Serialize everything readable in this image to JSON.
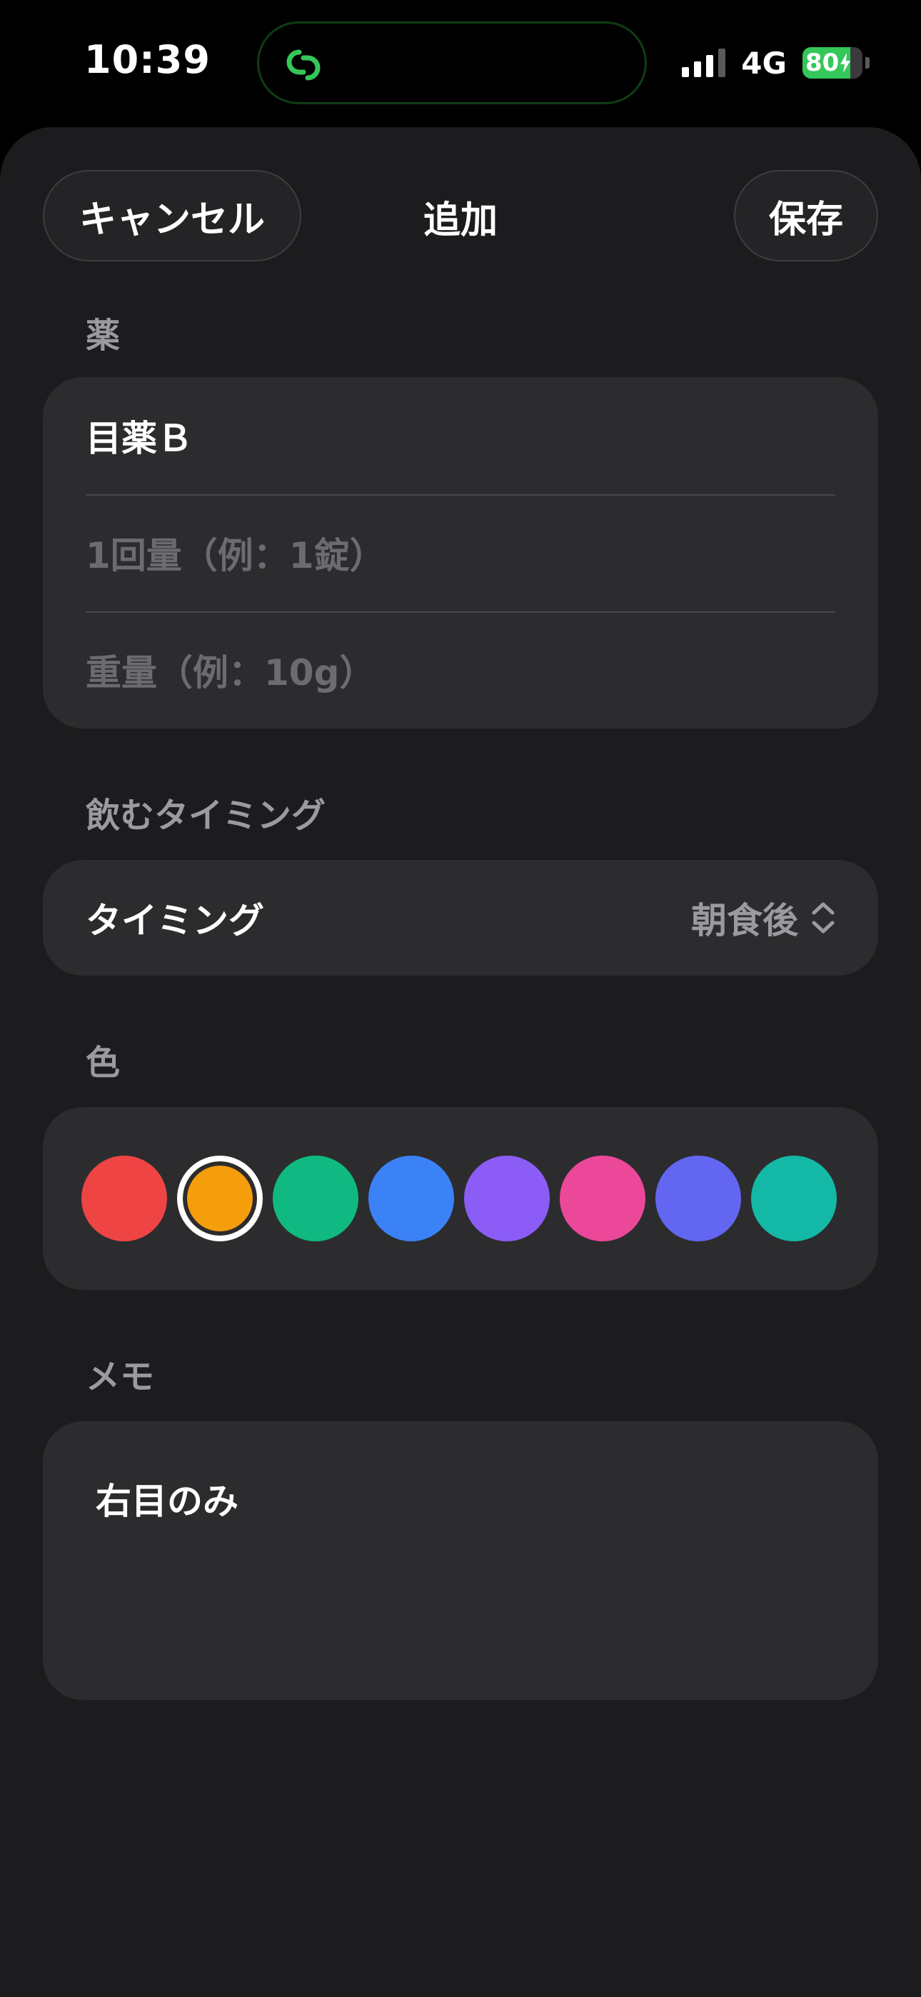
{
  "status_bar": {
    "time": "10:39",
    "network": "4G",
    "battery_label": "80",
    "battery_level": 0.8,
    "signal_bars": 3,
    "icons": [
      "link-icon",
      "signal-icon",
      "battery-icon",
      "charging-bolt-icon"
    ]
  },
  "nav": {
    "cancel_label": "キャンセル",
    "title": "追加",
    "save_label": "保存"
  },
  "medicine_section": {
    "label": "薬",
    "name_value": "目薬Ｂ",
    "dose_placeholder": "1回量（例：1錠）",
    "weight_placeholder": "重量（例：10g）"
  },
  "timing_section": {
    "label": "飲むタイミング",
    "row_label": "タイミング",
    "selected_value": "朝食後",
    "icon": "chevron-up-down-icon"
  },
  "color_section": {
    "label": "色",
    "selected_index": 1,
    "swatches": [
      "#ef4444",
      "#f59e0b",
      "#10b981",
      "#3b82f6",
      "#8b5cf6",
      "#ec4899",
      "#6366f1",
      "#14b8a6"
    ]
  },
  "memo_section": {
    "label": "メモ",
    "value": "右目のみ"
  },
  "colors": {
    "sheet_background": "#1c1c1e",
    "group_background": "#2c2c2e",
    "accent_green": "#34c759",
    "secondary_text": "#9a9a9f"
  }
}
